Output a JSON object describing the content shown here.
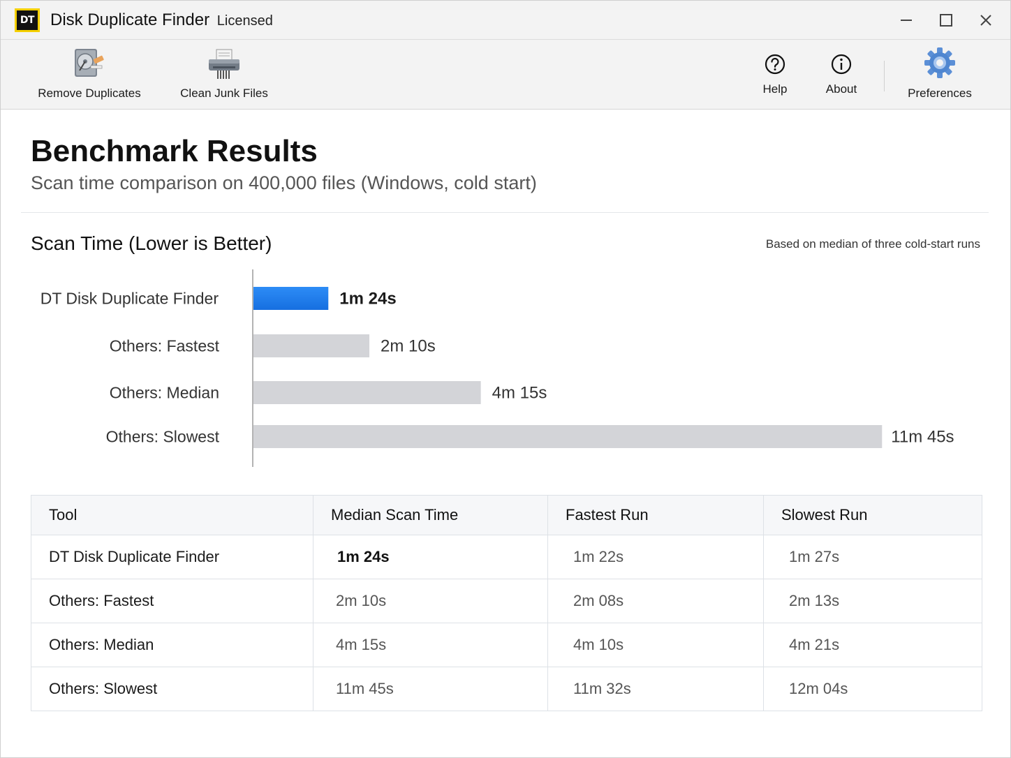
{
  "window": {
    "logo_text": "DT",
    "title": "Disk Duplicate Finder",
    "license": "Licensed"
  },
  "toolbar": {
    "remove_duplicates": {
      "label": "Remove Duplicates",
      "icon": "hard-drive-icon"
    },
    "clean_junk": {
      "label": "Clean Junk Files",
      "icon": "shredder-icon"
    },
    "help": {
      "label": "Help",
      "icon": "question-circle-icon"
    },
    "about": {
      "label": "About",
      "icon": "info-circle-icon"
    },
    "preferences": {
      "label": "Preferences",
      "icon": "gear-icon"
    }
  },
  "page": {
    "title": "Benchmark Results",
    "subtitle": "Scan time comparison on 400,000 files (Windows, cold start)"
  },
  "chart": {
    "title": "Scan Time (Lower is Better)",
    "note": "Based on median of three cold-start runs"
  },
  "chart_data": {
    "type": "bar",
    "orientation": "horizontal",
    "title": "Scan Time (Lower is Better)",
    "categories": [
      "DT Disk Duplicate Finder",
      "Others: Fastest",
      "Others: Median",
      "Others: Slowest"
    ],
    "values_seconds": [
      84,
      130,
      255,
      705
    ],
    "value_labels": [
      "1m 24s",
      "2m 10s",
      "4m 15s",
      "11m 45s"
    ],
    "colors": [
      "#1e7cf0",
      "#d3d4d8",
      "#d3d4d8",
      "#d3d4d8"
    ],
    "highlight_index": 0,
    "grid": false
  },
  "table": {
    "headers": [
      "Tool",
      "Median Scan Time",
      "Fastest Run",
      "Slowest Run"
    ],
    "rows": [
      [
        "DT Disk Duplicate Finder",
        "1m 24s",
        "1m 22s",
        "1m 27s"
      ],
      [
        "Others: Fastest",
        "2m 10s",
        "2m 08s",
        "2m 13s"
      ],
      [
        "Others: Median",
        "4m 15s",
        "4m 10s",
        "4m 21s"
      ],
      [
        "Others: Slowest",
        "11m 45s",
        "11m 32s",
        "12m 04s"
      ]
    ]
  },
  "colors": {
    "accent": "#1e7cf0",
    "bar_neutral": "#d3d4d8",
    "logo_border": "#f5d000"
  }
}
